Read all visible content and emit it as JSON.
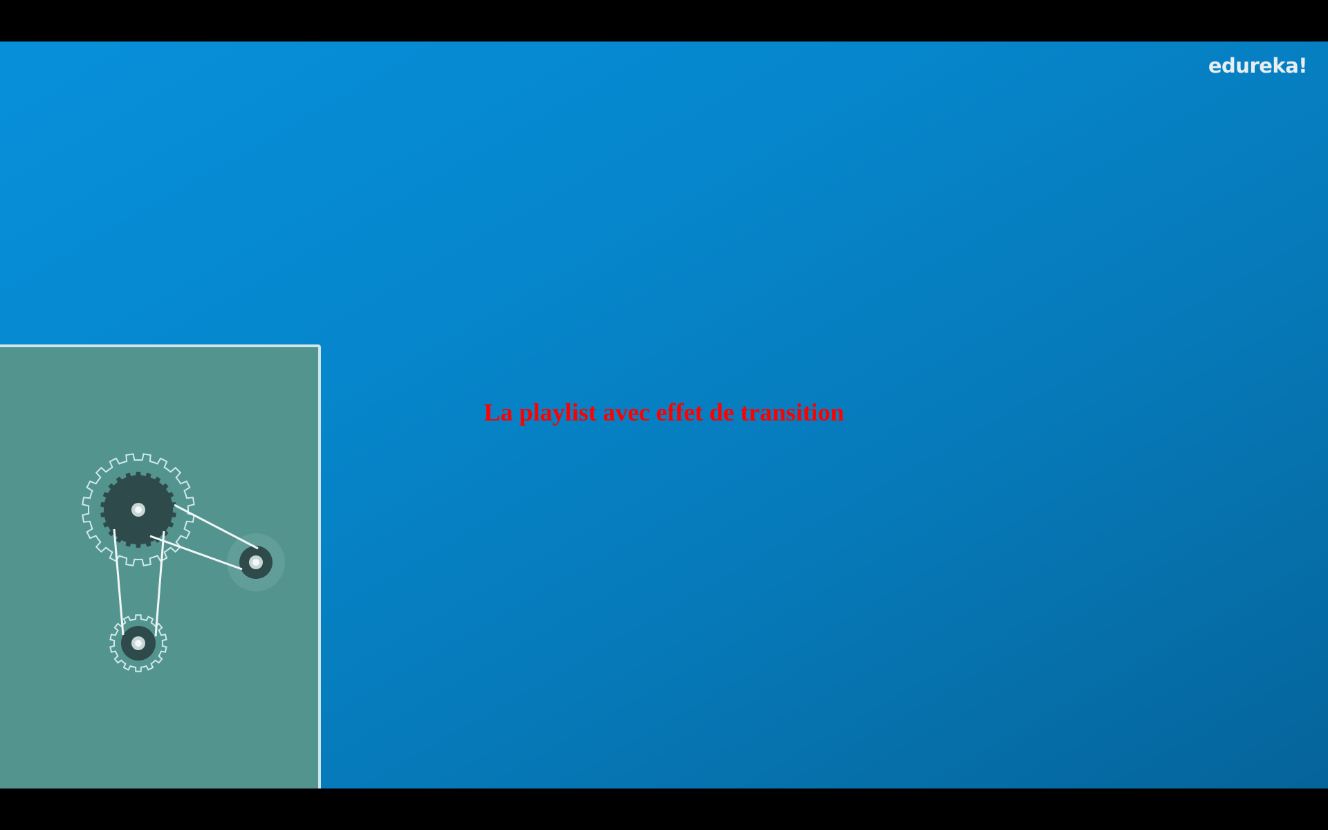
{
  "video": {
    "logo": "edureka!",
    "caption": "La playlist avec effet de transition"
  },
  "colors": {
    "background_blue": "#0686cc",
    "panel_teal": "#54948e",
    "caption_red": "#ff0000",
    "gear_dark": "#2f4a4a"
  }
}
